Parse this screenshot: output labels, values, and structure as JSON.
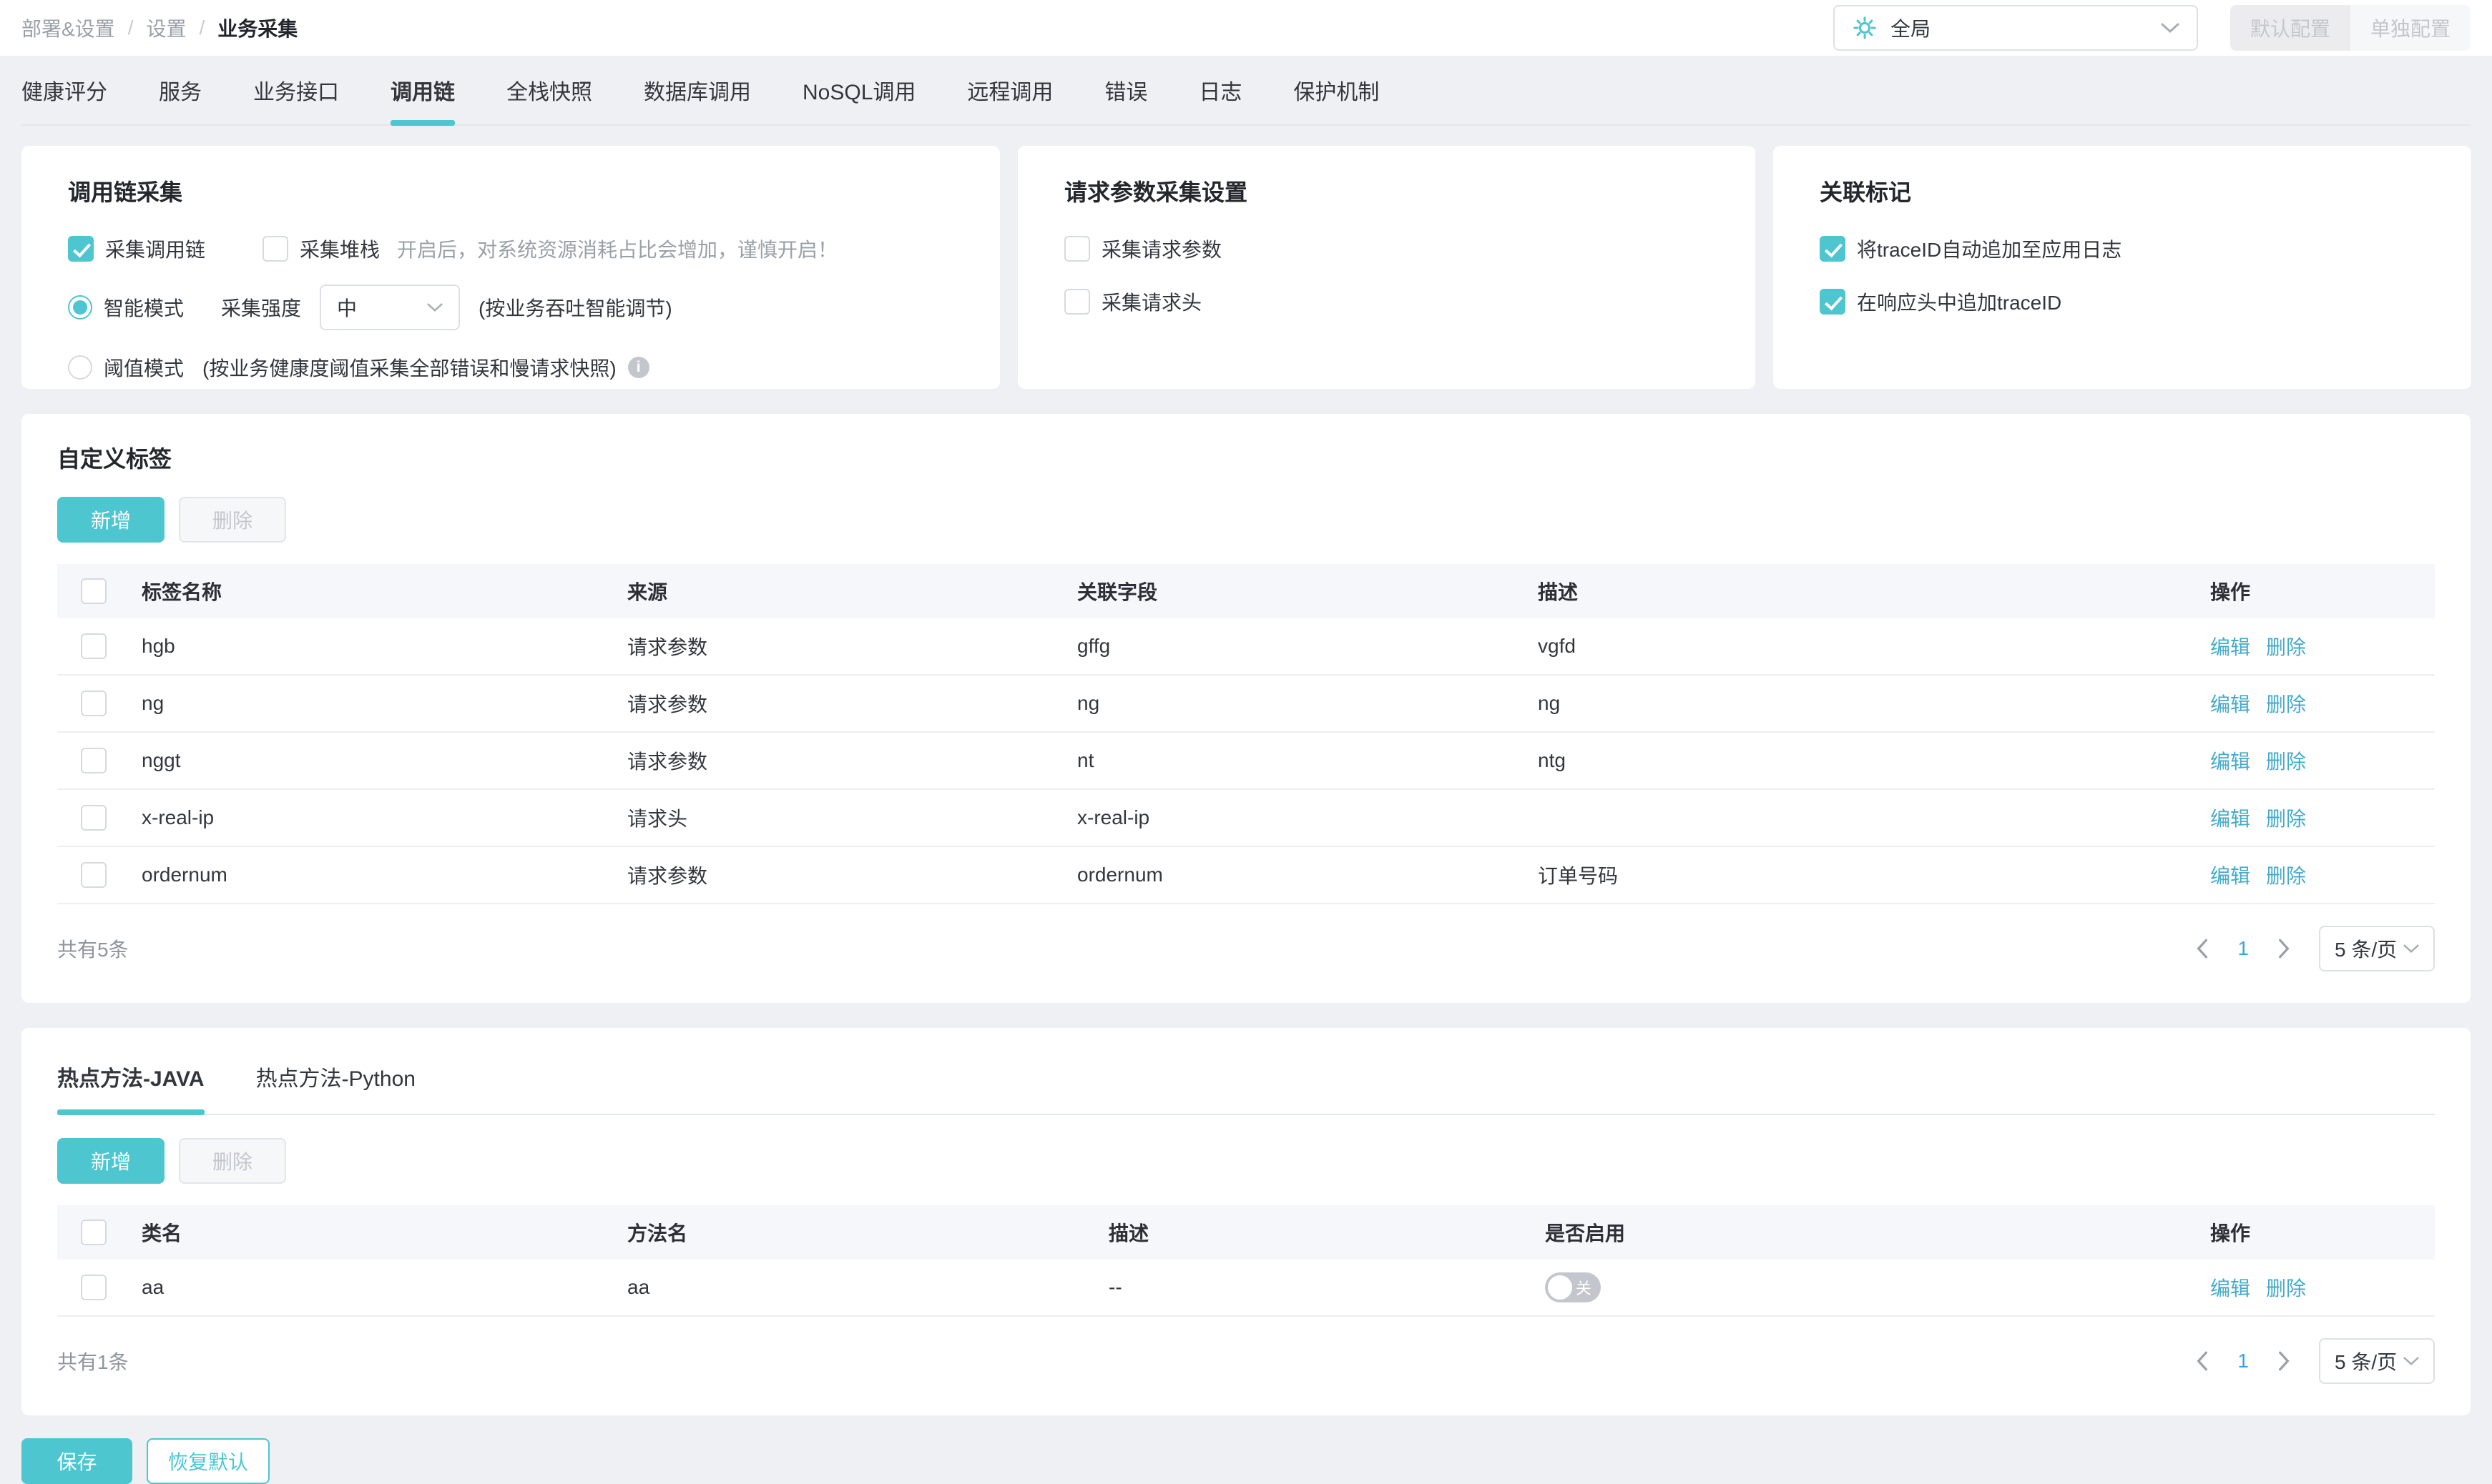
{
  "breadcrumb": {
    "items": [
      "部署&设置",
      "设置",
      "业务采集"
    ],
    "separator": "/"
  },
  "topbar": {
    "scope_value": "全局",
    "default_config_label": "默认配置",
    "separate_config_label": "单独配置"
  },
  "tabs": {
    "items": [
      "健康评分",
      "服务",
      "业务接口",
      "调用链",
      "全栈快照",
      "数据库调用",
      "NoSQL调用",
      "远程调用",
      "错误",
      "日志",
      "保护机制"
    ],
    "active": "调用链"
  },
  "trace_card": {
    "title": "调用链采集",
    "collect_trace": {
      "label": "采集调用链",
      "checked": true
    },
    "collect_stack": {
      "label": "采集堆栈",
      "checked": false,
      "hint": "开启后，对系统资源消耗占比会增加，谨慎开启！"
    },
    "smart_mode": {
      "label": "智能模式",
      "selected": true,
      "strength_label": "采集强度",
      "strength_value": "中",
      "note": "(按业务吞吐智能调节)"
    },
    "threshold_mode": {
      "label": "阈值模式",
      "selected": false,
      "note": "(按业务健康度阈值采集全部错误和慢请求快照)",
      "info_glyph": "i"
    }
  },
  "request_card": {
    "title": "请求参数采集设置",
    "collect_params": {
      "label": "采集请求参数",
      "checked": false
    },
    "collect_headers": {
      "label": "采集请求头",
      "checked": false
    }
  },
  "correlation_card": {
    "title": "关联标记",
    "append_log": {
      "label": "将traceID自动追加至应用日志",
      "checked": true
    },
    "append_header": {
      "label": "在响应头中追加traceID",
      "checked": true
    }
  },
  "custom_tags": {
    "title": "自定义标签",
    "add_label": "新增",
    "delete_label": "删除",
    "columns": [
      "标签名称",
      "来源",
      "关联字段",
      "描述",
      "操作"
    ],
    "rows": [
      {
        "name": "hgb",
        "source": "请求参数",
        "field": "gffg",
        "desc": "vgfd"
      },
      {
        "name": "ng",
        "source": "请求参数",
        "field": "ng",
        "desc": "ng"
      },
      {
        "name": "nggt",
        "source": "请求参数",
        "field": "nt",
        "desc": "ntg"
      },
      {
        "name": "x-real-ip",
        "source": "请求头",
        "field": "x-real-ip",
        "desc": ""
      },
      {
        "name": "ordernum",
        "source": "请求参数",
        "field": "ordernum",
        "desc": "订单号码"
      }
    ],
    "edit_label": "编辑",
    "remove_label": "删除",
    "total": "共有5条",
    "page": "1",
    "page_size": "5 条/页"
  },
  "hot_methods": {
    "tab_java": "热点方法-JAVA",
    "tab_python": "热点方法-Python",
    "active": "热点方法-JAVA",
    "add_label": "新增",
    "delete_label": "删除",
    "columns": [
      "类名",
      "方法名",
      "描述",
      "是否启用",
      "操作"
    ],
    "rows": [
      {
        "class_name": "aa",
        "method_name": "aa",
        "desc": "--",
        "enabled": false,
        "toggle_label": "关"
      }
    ],
    "edit_label": "编辑",
    "remove_label": "删除",
    "total": "共有1条",
    "page": "1",
    "page_size": "5 条/页"
  },
  "footer": {
    "save_label": "保存",
    "reset_label": "恢复默认"
  },
  "colors": {
    "accent": "#4dc6d0",
    "link": "#45abc9",
    "page_number": "#38a3e0",
    "page_bg": "#eef0f4"
  }
}
